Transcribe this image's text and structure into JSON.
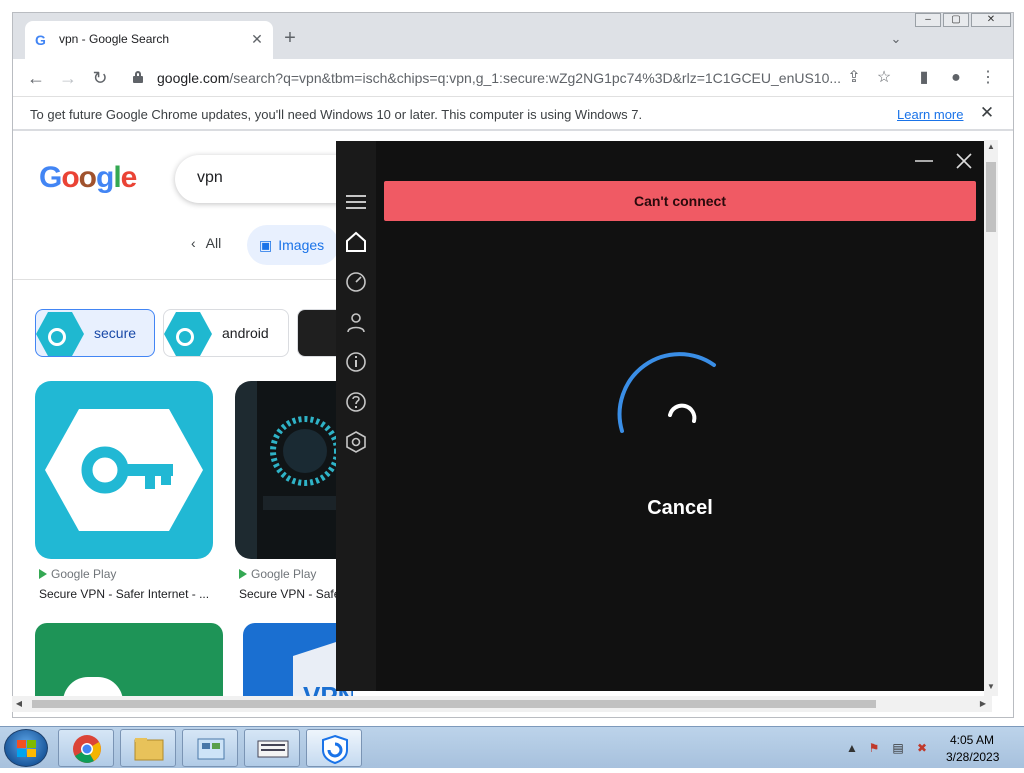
{
  "browser": {
    "tab_title": "vpn - Google Search",
    "url_host": "google.com",
    "url_rest": "/search?q=vpn&tbm=isch&chips=q:vpn,g_1:secure:wZg2NG1pc74%3D&rlz=1C1GCEU_enUS10...",
    "infobar_text": "To get future Google Chrome updates, you'll need Windows 10 or later. This computer is using Windows 7.",
    "infobar_link": "Learn more"
  },
  "google": {
    "search_value": "vpn",
    "filter_all": "All",
    "filter_images": "Images",
    "chips": [
      {
        "label": "secure"
      },
      {
        "label": "android"
      }
    ],
    "results": [
      {
        "source": "Google Play",
        "title": "Secure VPN - Safer Internet - ..."
      },
      {
        "source": "Google Play",
        "title": "Secure VPN - Safe"
      }
    ],
    "partial_tile_text": "VPN"
  },
  "vpn_app": {
    "status_banner": "Can't connect",
    "cancel_label": "Cancel",
    "banner_color": "#f05a64",
    "spinner_color": "#3a8ee6"
  },
  "taskbar": {
    "time": "4:05 AM",
    "date": "3/28/2023"
  }
}
